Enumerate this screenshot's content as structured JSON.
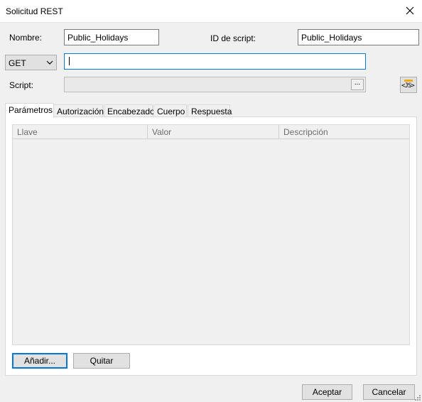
{
  "window": {
    "title": "Solicitud REST"
  },
  "form": {
    "name_label": "Nombre:",
    "name_value": "Public_Holidays",
    "script_id_label": "ID de script:",
    "script_id_value": "Public_Holidays",
    "method_value": "GET",
    "url_value": "",
    "script_label": "Script:",
    "script_value": "",
    "ellipsis_label": "...",
    "js_button_label": "<JS>"
  },
  "tabs": [
    {
      "label": "Parámetros"
    },
    {
      "label": "Autorización"
    },
    {
      "label": "Encabezado"
    },
    {
      "label": "Cuerpo"
    },
    {
      "label": "Respuesta"
    }
  ],
  "grid": {
    "columns": [
      {
        "label": "Llave"
      },
      {
        "label": "Valor"
      },
      {
        "label": "Descripción"
      }
    ],
    "rows": []
  },
  "actions": {
    "add_label": "Añadir...",
    "remove_label": "Quitar",
    "ok_label": "Aceptar",
    "cancel_label": "Cancelar"
  },
  "colors": {
    "accent": "#0078d7",
    "js_icon": "#f2a900"
  }
}
